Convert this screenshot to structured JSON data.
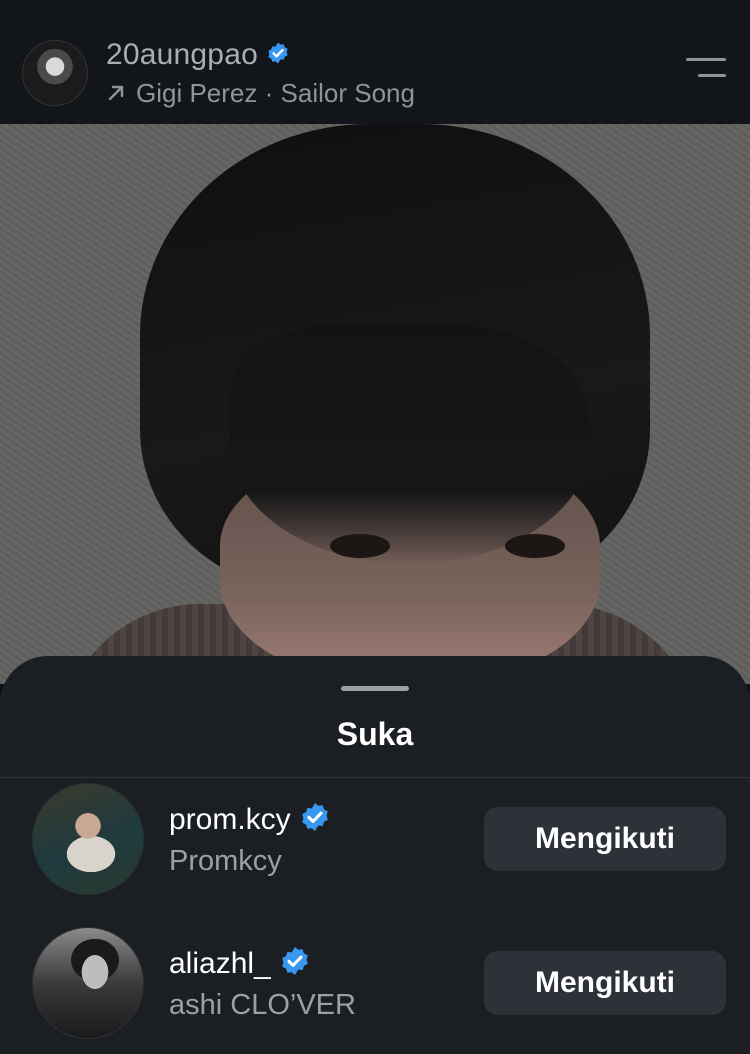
{
  "post_header": {
    "username": "20aungpao",
    "music_artist": "Gigi Perez",
    "separator": "·",
    "music_title": "Sailor Song"
  },
  "sheet": {
    "title": "Suka",
    "likers": [
      {
        "username": "prom.kcy",
        "full_name": "Promkcy",
        "verified": true,
        "button_label": "Mengikuti"
      },
      {
        "username": "aliazhl_",
        "full_name": "ashi CLO’VER",
        "verified": true,
        "button_label": "Mengikuti"
      }
    ]
  },
  "colors": {
    "verified_badge": "#3897f0",
    "sheet_background": "#1b1f23",
    "button_background": "#2d3238"
  }
}
